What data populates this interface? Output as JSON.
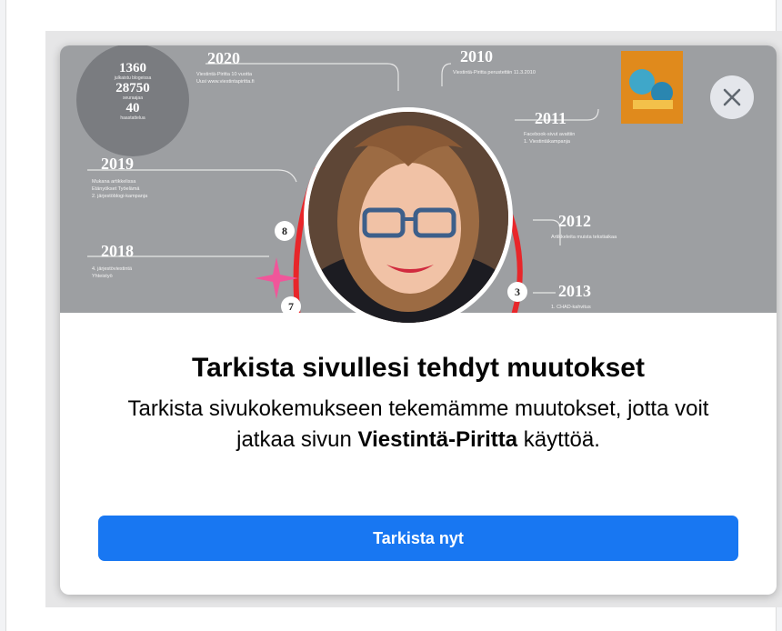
{
  "dialog": {
    "title": "Tarkista sivullesi tehdyt muutokset",
    "description_before": "Tarkista sivukokemukseen tekemämme muutokset, jotta voit jatkaa sivun ",
    "page_name": "Viestintä-Piritta",
    "description_after": " käyttöä.",
    "primary_button_label": "Tarkista nyt",
    "close_icon": "close-icon"
  },
  "cover": {
    "stats": [
      {
        "value": "1360",
        "label": "julkaistu blogeissa"
      },
      {
        "value": "28750",
        "label": "seuraajaa"
      },
      {
        "value": "40",
        "label": "haastattelua"
      }
    ],
    "years": {
      "y2020": "2020",
      "y2019": "2019",
      "y2018": "2018",
      "y2010": "2010",
      "y2011": "2011",
      "y2012": "2012",
      "y2013": "2013"
    },
    "notes": {
      "n2020": [
        "Viestintä-Piritta 10 vuotta",
        "Uusi www.viestintapiritta.fi"
      ],
      "n2019": [
        "Mukana artikkelissa",
        "Etänyökset Työelämä",
        "2. järjestöblogi-kampanja"
      ],
      "n2018": [
        "4. järjestöviestintä",
        "Yhteistyö"
      ],
      "n2010": [
        "Viestintä-Piritta perustettiin 11.3.2010"
      ],
      "n2011": [
        "Facebook-sivut avattiin",
        "1. Viestintäkampanja"
      ],
      "n2012": [
        "Artikkeleita muista tekstiaikaa"
      ],
      "n2013": [
        "1. CHAD-kahvitus"
      ]
    },
    "badges": [
      "8",
      "7",
      "3"
    ],
    "book_icon": "book-cover-icon"
  },
  "colors": {
    "primary": "#1877f2",
    "cover_bg": "#9d9fa2",
    "timeline_red": "#e8262a",
    "sparkle_pink": "#f0569a"
  }
}
